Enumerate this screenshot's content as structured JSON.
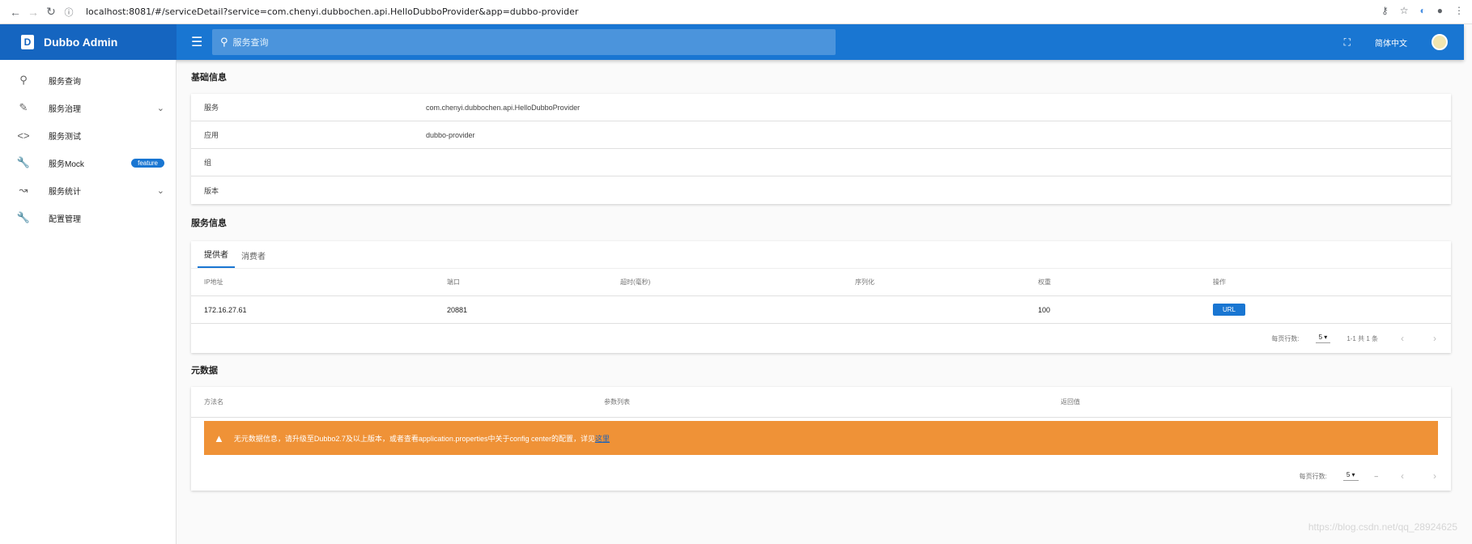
{
  "browser": {
    "url_host": "localhost",
    "url_rest": ":8081/#/serviceDetail?service=com.chenyi.dubbochen.api.HelloDubboProvider&app=dubbo-provider"
  },
  "header": {
    "brand": "Dubbo Admin",
    "brand_logo": "D",
    "search_placeholder": "服务查询",
    "language": "简体中文"
  },
  "sidebar": {
    "items": [
      {
        "label": "服务查询",
        "icon": "search-icon"
      },
      {
        "label": "服务治理",
        "icon": "pencil-icon"
      },
      {
        "label": "服务测试",
        "icon": "code-icon"
      },
      {
        "label": "服务Mock",
        "icon": "wrench-icon",
        "badge": "feature"
      },
      {
        "label": "服务统计",
        "icon": "trending-icon"
      },
      {
        "label": "配置管理",
        "icon": "wrench-icon"
      }
    ]
  },
  "basic": {
    "title": "基础信息",
    "rows": [
      {
        "key": "服务",
        "value": "com.chenyi.dubbochen.api.HelloDubboProvider"
      },
      {
        "key": "应用",
        "value": "dubbo-provider"
      },
      {
        "key": "组",
        "value": ""
      },
      {
        "key": "版本",
        "value": ""
      }
    ]
  },
  "service": {
    "title": "服务信息",
    "tabs": [
      "提供者",
      "消费者"
    ],
    "columns": [
      "IP地址",
      "端口",
      "超时(毫秒)",
      "序列化",
      "权重",
      "操作"
    ],
    "rows": [
      {
        "ip": "172.16.27.61",
        "port": "20881",
        "timeout": "",
        "serialization": "",
        "weight": "100",
        "action": "URL"
      }
    ],
    "pager": {
      "rows_label": "每页行数:",
      "rows_value": "5",
      "range": "1-1 共 1 条"
    }
  },
  "meta": {
    "title": "元数据",
    "columns": [
      "方法名",
      "参数列表",
      "返回值"
    ],
    "warning": "无元数据信息，请升级至Dubbo2.7及以上版本，或者查看application.properties中关于config center的配置，详见",
    "warning_link": "这里",
    "pager": {
      "rows_label": "每页行数:",
      "rows_value": "5",
      "range": "–"
    }
  },
  "watermark": "https://blog.csdn.net/qq_28924625"
}
